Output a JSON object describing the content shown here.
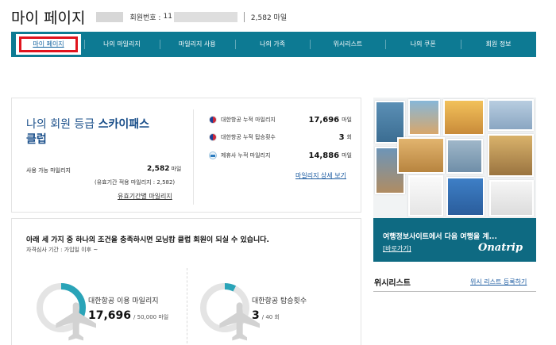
{
  "header": {
    "title": "마이 페이지",
    "member_label": "회원번호 :",
    "member_no_visible": "11",
    "miles": "2,582 마일"
  },
  "nav": {
    "items": [
      {
        "label": "마이 페이지",
        "active": true
      },
      {
        "label": "나의 마일리지"
      },
      {
        "label": "마일리지 사용"
      },
      {
        "label": "나의 가족"
      },
      {
        "label": "위시리스트"
      },
      {
        "label": "나의 쿠폰"
      },
      {
        "label": "회원 정보"
      }
    ]
  },
  "grade": {
    "line1_prefix": "나의 회원 등급",
    "line1_grade": "스카이패스",
    "line2": "클럽",
    "available_label": "사용 가능 마일리지",
    "available_value": "2,582",
    "available_unit": "마일",
    "available_note": "(유효기간 적용 마일리지 : 2,582)",
    "expiry_link": "유효기간별 마일리지",
    "stats": [
      {
        "label": "대한항공 누적 마일리지",
        "value": "17,696",
        "unit": "마일",
        "icon": "korean-air-icon"
      },
      {
        "label": "대한항공 누적 탑승횟수",
        "value": "3",
        "unit": "회",
        "icon": "korean-air-icon"
      },
      {
        "label": "제휴사 누적 마일리지",
        "value": "14,886",
        "unit": "마일",
        "icon": "partner-icon"
      }
    ],
    "detail_link": "마일리지 상세 보기"
  },
  "morning_calm": {
    "title": "아래 세 가지 중 하나의 조건을 충족하시면 모닝캄 클럽 회원이 되실 수 있습니다.",
    "subtitle": "자격심사 기간 : 가입일 이후 ~",
    "items": [
      {
        "label": "대한항공 이용 마일리지",
        "value": "17,696",
        "target": "/ 50,000 마일",
        "progress": 0.354
      },
      {
        "label": "대한항공 탑승횟수",
        "value": "3",
        "target": "/ 40 회",
        "progress": 0.075
      }
    ],
    "colors": {
      "progress": "#2aa4b8",
      "track": "#e4e4e4"
    }
  },
  "banner": {
    "title": "여행정보사이트에서 다음 여행을 계...",
    "link": "[바로가기]",
    "logo": "Onatrip"
  },
  "wishlist": {
    "title": "위시리스트",
    "link": "위시 리스트 등록하기"
  },
  "colors": {
    "nav": "#0d7a93",
    "grade_text": "#1a4f8a",
    "active_outline": "#e0141e",
    "banner_caption": "#0e6a82"
  }
}
